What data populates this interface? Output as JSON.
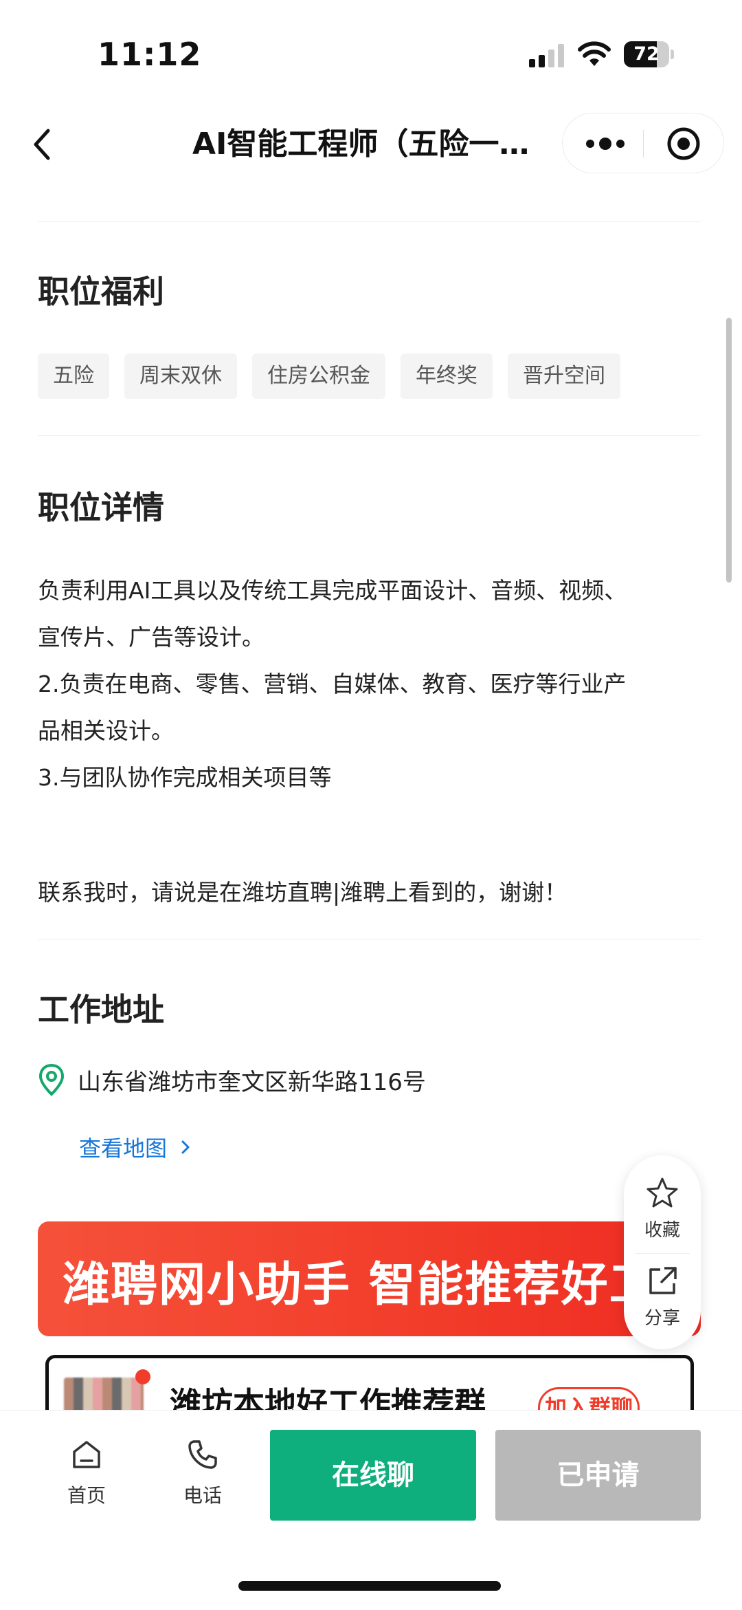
{
  "status_bar": {
    "time": "11:12",
    "battery_level": "72",
    "battery_fraction": 0.72
  },
  "nav": {
    "title": "AI智能工程师（五险一…"
  },
  "benefits": {
    "title": "职位福利",
    "tags": [
      "五险",
      "周末双休",
      "住房公积金",
      "年终奖",
      "晋升空间"
    ]
  },
  "details": {
    "title": "职位详情",
    "lines": [
      "负责利用AI工具以及传统工具完成平面设计、音频、视频、",
      "宣传片、广告等设计。",
      "2.负责在电商、零售、营销、自媒体、教育、医疗等行业产",
      "品相关设计。",
      "3.与团队协作完成相关项目等"
    ],
    "contact_note": "联系我时，请说是在潍坊直聘|潍聘上看到的，谢谢！"
  },
  "location": {
    "title": "工作地址",
    "address": "山东省潍坊市奎文区新华路116号",
    "map_link": "查看地图"
  },
  "banner": {
    "text": "潍聘网小助手 智能推荐好工"
  },
  "group_card": {
    "title": "潍坊本地好工作推荐群",
    "join_label": "加入群聊"
  },
  "float_actions": {
    "favorite_label": "收藏",
    "share_label": "分享"
  },
  "bottom_bar": {
    "home_label": "首页",
    "phone_label": "电话",
    "chat_label": "在线聊",
    "applied_label": "已申请"
  },
  "colors": {
    "primary_green": "#0fae7d",
    "link_blue": "#1677d9",
    "banner_red": "#f23c2a",
    "disabled_gray": "#b8b8b8",
    "pin_green": "#14a86a"
  }
}
